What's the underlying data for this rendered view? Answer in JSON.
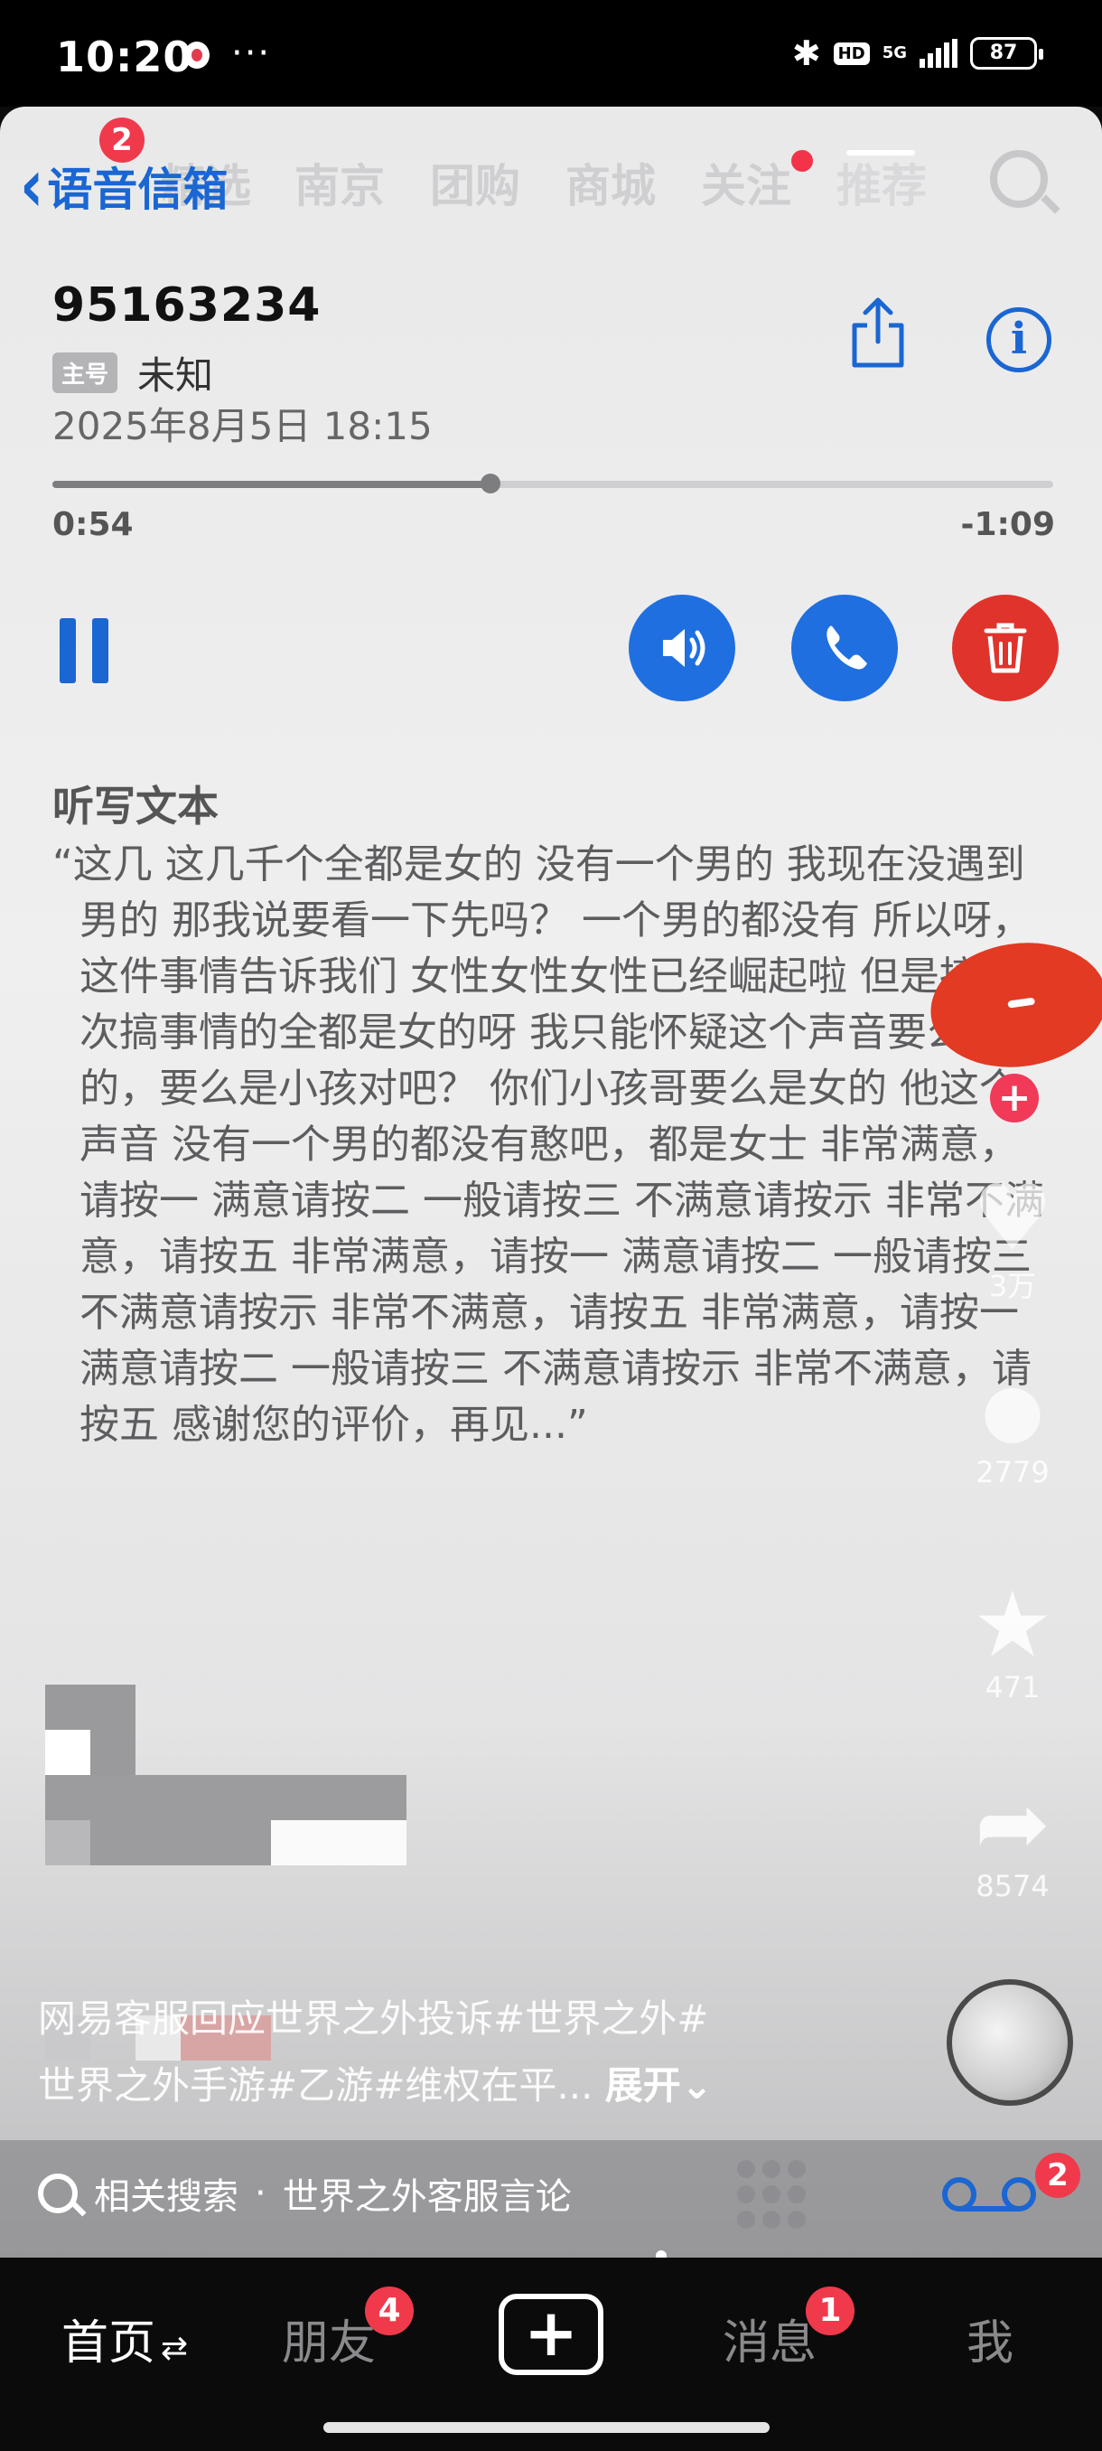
{
  "status_bar": {
    "time": "10:20",
    "dots": "···",
    "bluetooth": "✱",
    "hd": "HD",
    "network": "5G",
    "battery": "87"
  },
  "background_tabs": {
    "items": [
      "精选",
      "南京",
      "团购",
      "商城",
      "关注",
      "推荐"
    ]
  },
  "voicemail": {
    "back_label": "语音信箱",
    "back_badge": "2",
    "number": "95163234",
    "tag": "主号",
    "caller_label": "未知",
    "datetime": "2025年8月5日 18:15",
    "progress": 0.438,
    "elapsed": "0:54",
    "remaining": "-1:09",
    "transcript_title": "听写文本",
    "transcript": "“这几 这几千个全都是女的 没有一个男的 我现在没遇到男的 那我说要看一下先吗？ 一个男的都没有 所以呀，这件事情告诉我们 女性女性女性已经崛起啦 但是搞这次搞事情的全都是女的呀 我只能怀疑这个声音要么是女的，要么是小孩对吧？ 你们小孩哥要么是女的 他这个声音 没有一个男的都没有憨吧，都是女士 非常满意，请按一 满意请按二 一般请按三 不满意请按示 非常不满意，请按五 非常满意，请按一 满意请按二 一般请按三 不满意请按示 非常不满意，请按五 非常满意，请按一 满意请按二 一般请按三 不满意请按示 非常不满意，请按五 感谢您的评价，再见...”"
  },
  "side_actions": {
    "like_count": "3万",
    "comment_count": "2779",
    "favorite_count": "471",
    "share_count": "8574",
    "follow_plus": "+"
  },
  "caption": {
    "line1": "网易客服回应世界之外投诉#世界之外#",
    "line2": "世界之外手游#乙游#维权在平...",
    "expand": "展开"
  },
  "related_search": {
    "prefix": "相关搜索",
    "separator": "·",
    "query": "世界之外客服言论"
  },
  "dock": {
    "voicemail_badge": "2"
  },
  "tab_bar": {
    "home": "首页",
    "home_swap": "⇄",
    "friends": "朋友",
    "friends_badge": "4",
    "add": "+",
    "messages": "消息",
    "messages_badge": "1",
    "me": "我"
  },
  "colors": {
    "ios_blue": "#1a66d2",
    "delete_red": "#e0332b",
    "badge_red": "#f03a4c"
  }
}
